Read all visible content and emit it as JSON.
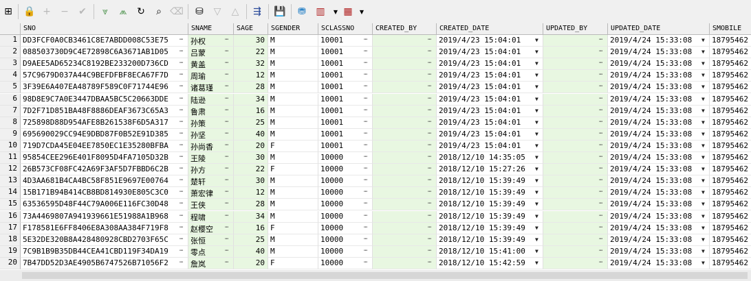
{
  "toolbar_icons": [
    "grid-toggle-icon",
    "lock-icon",
    "add-record-icon",
    "delete-record-icon",
    "post-edit-icon",
    "filter-down-icon",
    "filter-clear-icon",
    "refresh-icon",
    "find-icon",
    "clear-icon",
    "query-by-example-icon",
    "sort-asc-icon",
    "sort-desc-icon",
    "connection-icon",
    "save-icon",
    "export-icon",
    "chart-icon",
    "single-record-view-icon"
  ],
  "columns": [
    {
      "key": "sno",
      "label": "SNO"
    },
    {
      "key": "sname",
      "label": "SNAME"
    },
    {
      "key": "sage",
      "label": "SAGE"
    },
    {
      "key": "sgender",
      "label": "SGENDER"
    },
    {
      "key": "sclassno",
      "label": "SCLASSNO"
    },
    {
      "key": "created_by",
      "label": "CREATED_BY"
    },
    {
      "key": "created_date",
      "label": "CREATED_DATE"
    },
    {
      "key": "updated_by",
      "label": "UPDATED_BY"
    },
    {
      "key": "updated_date",
      "label": "UPDATED_DATE"
    },
    {
      "key": "smobile",
      "label": "SMOBILE"
    }
  ],
  "rows": [
    {
      "n": "1",
      "sno": "DD3FCF0A0CB3461C8E7ABDD008C53E75",
      "sname": "孙权",
      "sage": "30",
      "sgender": "M",
      "sclassno": "10001",
      "created_date": "2019/4/23 15:04:01",
      "updated_date": "2019/4/24 15:33:08",
      "smobile": "18795462"
    },
    {
      "n": "2",
      "sno": "088503730D9C4E72898C6A3671AB1D05",
      "sname": "吕蒙",
      "sage": "22",
      "sgender": "M",
      "sclassno": "10001",
      "created_date": "2019/4/23 15:04:01",
      "updated_date": "2019/4/24 15:33:08",
      "smobile": "18795462"
    },
    {
      "n": "3",
      "sno": "D9AEE5AD65234C8192BE233200D736CD",
      "sname": "黄盖",
      "sage": "32",
      "sgender": "M",
      "sclassno": "10001",
      "created_date": "2019/4/23 15:04:01",
      "updated_date": "2019/4/24 15:33:08",
      "smobile": "18795462"
    },
    {
      "n": "4",
      "sno": "57C9679D037A44C9BEFDFBF8ECA67F7D",
      "sname": "周瑜",
      "sage": "12",
      "sgender": "M",
      "sclassno": "10001",
      "created_date": "2019/4/23 15:04:01",
      "updated_date": "2019/4/24 15:33:08",
      "smobile": "18795462"
    },
    {
      "n": "5",
      "sno": "3F39E6A407EA48789F589C0F71744E96",
      "sname": "诸葛瑾",
      "sage": "28",
      "sgender": "M",
      "sclassno": "10001",
      "created_date": "2019/4/23 15:04:01",
      "updated_date": "2019/4/24 15:33:08",
      "smobile": "18795462"
    },
    {
      "n": "6",
      "sno": "98D8E9C7A0E3447DBAA5BC5C20663DDE",
      "sname": "陆逊",
      "sage": "34",
      "sgender": "M",
      "sclassno": "10001",
      "created_date": "2019/4/23 15:04:01",
      "updated_date": "2019/4/24 15:33:08",
      "smobile": "18795462"
    },
    {
      "n": "7",
      "sno": "7D2F71D851BA48F8886DEAF3673C65A3",
      "sname": "鲁肃",
      "sage": "16",
      "sgender": "M",
      "sclassno": "10001",
      "created_date": "2019/4/23 15:04:01",
      "updated_date": "2019/4/24 15:33:08",
      "smobile": "18795462"
    },
    {
      "n": "8",
      "sno": "725898D88D954AFE8B261538F6D5A317",
      "sname": "孙策",
      "sage": "25",
      "sgender": "M",
      "sclassno": "10001",
      "created_date": "2019/4/23 15:04:01",
      "updated_date": "2019/4/24 15:33:08",
      "smobile": "18795462"
    },
    {
      "n": "9",
      "sno": "695690029CC94E9DBD87F0B52E91D385",
      "sname": "孙坚",
      "sage": "40",
      "sgender": "M",
      "sclassno": "10001",
      "created_date": "2019/4/23 15:04:01",
      "updated_date": "2019/4/24 15:33:08",
      "smobile": "18795462"
    },
    {
      "n": "10",
      "sno": "719D7CDA45E04EE7850EC1E35280BFBA",
      "sname": "孙尚香",
      "sage": "20",
      "sgender": "F",
      "sclassno": "10001",
      "created_date": "2019/4/23 15:04:01",
      "updated_date": "2019/4/24 15:33:08",
      "smobile": "18795462"
    },
    {
      "n": "11",
      "sno": "95854CEE296E401F8095D4FA7105D32B",
      "sname": "王陵",
      "sage": "30",
      "sgender": "M",
      "sclassno": "10000",
      "created_date": "2018/12/10 14:35:05",
      "updated_date": "2019/4/24 15:33:08",
      "smobile": "18795462"
    },
    {
      "n": "12",
      "sno": "26B573CF08FC42A69F3AF5D7FBBD6C2B",
      "sname": "孙方",
      "sage": "22",
      "sgender": "F",
      "sclassno": "10000",
      "created_date": "2018/12/10 15:27:26",
      "updated_date": "2019/4/24 15:33:08",
      "smobile": "18795462"
    },
    {
      "n": "13",
      "sno": "4D3AA681B4CA4BC58F851E9697E00764",
      "sname": "楚轩",
      "sage": "30",
      "sgender": "M",
      "sclassno": "10000",
      "created_date": "2018/12/10 15:39:49",
      "updated_date": "2019/4/24 15:33:08",
      "smobile": "18795462"
    },
    {
      "n": "14",
      "sno": "15B171B94B414CB8BD814930E805C3C0",
      "sname": "萧宏律",
      "sage": "12",
      "sgender": "M",
      "sclassno": "10000",
      "created_date": "2018/12/10 15:39:49",
      "updated_date": "2019/4/24 15:33:08",
      "smobile": "18795462"
    },
    {
      "n": "15",
      "sno": "63536595D48F44C79A006E116FC30D48",
      "sname": "王侠",
      "sage": "28",
      "sgender": "M",
      "sclassno": "10000",
      "created_date": "2018/12/10 15:39:49",
      "updated_date": "2019/4/24 15:33:08",
      "smobile": "18795462"
    },
    {
      "n": "16",
      "sno": "73A4469807A941939661E51988A1B968",
      "sname": "程啸",
      "sage": "34",
      "sgender": "M",
      "sclassno": "10000",
      "created_date": "2018/12/10 15:39:49",
      "updated_date": "2019/4/24 15:33:08",
      "smobile": "18795462"
    },
    {
      "n": "17",
      "sno": "F178581E6FF8406E8A308AA384F719F8",
      "sname": "赵樱空",
      "sage": "16",
      "sgender": "F",
      "sclassno": "10000",
      "created_date": "2018/12/10 15:39:49",
      "updated_date": "2019/4/24 15:33:08",
      "smobile": "18795462"
    },
    {
      "n": "18",
      "sno": "5E32DE320B8A428480928CBD2703F65C",
      "sname": "张恒",
      "sage": "25",
      "sgender": "M",
      "sclassno": "10000",
      "created_date": "2018/12/10 15:39:49",
      "updated_date": "2019/4/24 15:33:08",
      "smobile": "18795462"
    },
    {
      "n": "19",
      "sno": "7C9B1B9B35DB44CEA41CBD119F34DA19",
      "sname": "零点",
      "sage": "40",
      "sgender": "M",
      "sclassno": "10000",
      "created_date": "2018/12/10 15:41:00",
      "updated_date": "2019/4/24 15:33:08",
      "smobile": "18795462"
    },
    {
      "n": "20",
      "sno": "7B47DD52D3AE4905B6747526B71056F2",
      "sname": "詹岚",
      "sage": "20",
      "sgender": "F",
      "sclassno": "10000",
      "created_date": "2018/12/10 15:42:59",
      "updated_date": "2019/4/24 15:33:08",
      "smobile": "18795462"
    }
  ],
  "colors": {
    "row_highlight": "#e8f7e1",
    "header_bg": "#f0f0f0"
  }
}
